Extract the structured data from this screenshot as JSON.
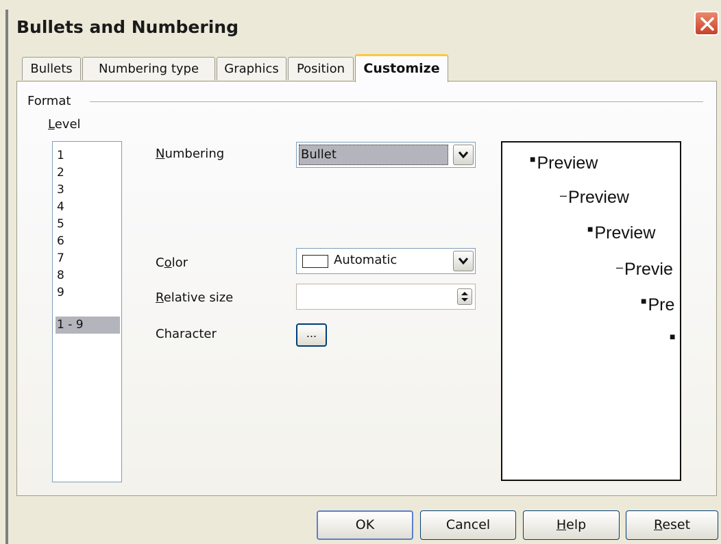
{
  "window": {
    "title": "Bullets and Numbering"
  },
  "tabs": [
    {
      "label": "Bullets"
    },
    {
      "label": "Numbering type"
    },
    {
      "label": "Graphics"
    },
    {
      "label": "Position"
    },
    {
      "label": "Customize"
    }
  ],
  "active_tab": "Customize",
  "format": {
    "group_label": "Format",
    "level_label": "Level",
    "levels": [
      "1",
      "2",
      "3",
      "4",
      "5",
      "6",
      "7",
      "8",
      "9",
      "1 - 9"
    ],
    "selected_level": "1 - 9",
    "numbering_label": "Numbering",
    "numbering_value": "Bullet",
    "color_label": "Color",
    "color_value": "Automatic",
    "relative_size_label": "Relative size",
    "relative_size_value": "",
    "character_label": "Character",
    "character_button": "..."
  },
  "preview": {
    "lines": [
      "Preview",
      "Preview",
      "Preview",
      "Previe",
      "Pre",
      ""
    ],
    "markers": [
      "bullet",
      "dash",
      "bullet",
      "dash",
      "bullet",
      "bullet"
    ]
  },
  "buttons": {
    "ok": "OK",
    "cancel": "Cancel",
    "help": "Help",
    "reset": "Reset"
  },
  "colors": {
    "dialog_bg": "#ece9d8",
    "active_tab_accent": "#ffc83c",
    "selection": "#b4b4bc",
    "close_button": "#c8412a"
  }
}
